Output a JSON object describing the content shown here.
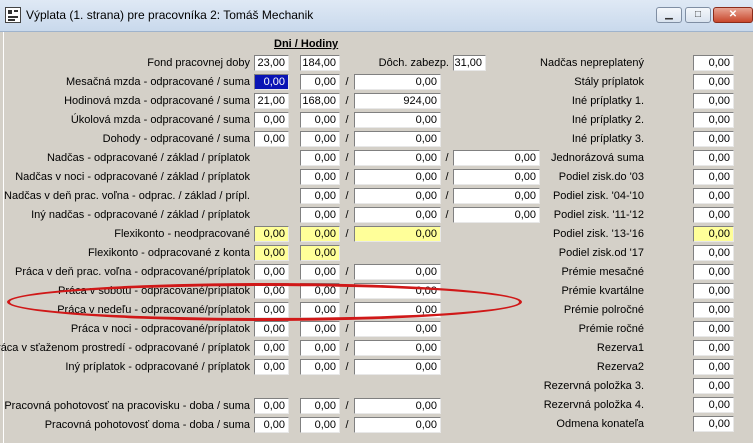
{
  "window": {
    "title": "Výplata (1. strana) pre pracovníka 2: Tomáš Mechanik",
    "min_symbol": "▁",
    "max_symbol": "□",
    "close_symbol": "✕"
  },
  "header": {
    "dni_hodiny": "Dni / Hodiny"
  },
  "fond": {
    "label": "Fond pracovnej doby",
    "days": "23,00",
    "hours": "184,00",
    "doch_label": "Dôch. zabezp.",
    "doch_value": "31,00"
  },
  "left_rows": [
    {
      "label": "Mesačná mzda - odpracované / suma",
      "v1": "0,00",
      "v2": "0,00",
      "v3": "0,00"
    },
    {
      "label": "Hodinová mzda - odpracované / suma",
      "v1": "21,00",
      "v2": "168,00",
      "v3": "924,00"
    },
    {
      "label": "Úkolová mzda - odpracované / suma",
      "v1": "0,00",
      "v2": "0,00",
      "v3": "0,00"
    },
    {
      "label": "Dohody - odpracované / suma",
      "v1": "0,00",
      "v2": "0,00",
      "v3": "0,00"
    },
    {
      "label": "Nadčas - odpracované / základ / príplatok",
      "v2": "0,00",
      "v3": "0,00",
      "v4": "0,00"
    },
    {
      "label": "Nadčas v noci - odpracované / základ / príplatok",
      "v2": "0,00",
      "v3": "0,00",
      "v4": "0,00"
    },
    {
      "label": "Nadčas v deň prac. voľna - odprac. / základ / prípl.",
      "v2": "0,00",
      "v3": "0,00",
      "v4": "0,00"
    },
    {
      "label": "Iný nadčas - odpracované / základ / príplatok",
      "v2": "0,00",
      "v3": "0,00",
      "v4": "0,00"
    },
    {
      "label": "Flexikonto - neodpracované",
      "v1": "0,00",
      "v2": "0,00",
      "v3": "0,00"
    },
    {
      "label": "Flexikonto - odpracované z konta",
      "v1": "0,00",
      "v2": "0,00"
    },
    {
      "label": "Práca v deň prac. voľna - odpracované/príplatok",
      "v1": "0,00",
      "v2": "0,00",
      "v3": "0,00"
    },
    {
      "label": "Práca v sobotu - odpracované/príplatok",
      "v1": "0,00",
      "v2": "0,00",
      "v3": "0,00"
    },
    {
      "label": "Práca v nedeľu - odpracované/príplatok",
      "v1": "0,00",
      "v2": "0,00",
      "v3": "0,00"
    },
    {
      "label": "Práca v noci - odpracované/príplatok",
      "v1": "0,00",
      "v2": "0,00",
      "v3": "0,00"
    },
    {
      "label": "Práca v sťaženom prostredí - odpracované / príplatok",
      "v1": "0,00",
      "v2": "0,00",
      "v3": "0,00"
    },
    {
      "label": "Iný príplatok - odpracované / príplatok",
      "v1": "0,00",
      "v2": "0,00",
      "v3": "0,00"
    },
    {
      "label": "Pracovná pohotovosť na pracovisku - doba / suma",
      "v1": "0,00",
      "v2": "0,00",
      "v3": "0,00"
    },
    {
      "label": "Pracovná pohotovosť doma - doba / suma",
      "v1": "0,00",
      "v2": "0,00",
      "v3": "0,00"
    }
  ],
  "right_rows": [
    {
      "label": "Nadčas nepreplatený",
      "value": "0,00"
    },
    {
      "label": "Stály príplatok",
      "value": "0,00"
    },
    {
      "label": "Iné príplatky 1.",
      "value": "0,00"
    },
    {
      "label": "Iné príplatky 2.",
      "value": "0,00"
    },
    {
      "label": "Iné príplatky 3.",
      "value": "0,00"
    },
    {
      "label": "Jednorázová suma",
      "value": "0,00"
    },
    {
      "label": "Podiel zisk.do '03",
      "value": "0,00"
    },
    {
      "label": "Podiel zisk. '04-'10",
      "value": "0,00"
    },
    {
      "label": "Podiel zisk. '11-'12",
      "value": "0,00"
    },
    {
      "label": "Podiel zisk. '13-'16",
      "value": "0,00"
    },
    {
      "label": "Podiel zisk.od '17",
      "value": "0,00"
    },
    {
      "label": "Prémie mesačné",
      "value": "0,00"
    },
    {
      "label": "Prémie kvartálne",
      "value": "0,00"
    },
    {
      "label": "Prémie polročné",
      "value": "0,00"
    },
    {
      "label": "Prémie ročné",
      "value": "0,00"
    },
    {
      "label": "Rezerva1",
      "value": "0,00"
    },
    {
      "label": "Rezerva2",
      "value": "0,00"
    },
    {
      "label": "Rezervná položka 3.",
      "value": "0,00"
    },
    {
      "label": "Rezervná položka 4.",
      "value": "0,00"
    },
    {
      "label": "Odmena konateľa",
      "value": "0,00"
    }
  ],
  "separator": "/",
  "colors": {
    "field_yellow": "#ffff99",
    "selection_blue": "#0a14b4",
    "annotation_red": "#d01818"
  }
}
